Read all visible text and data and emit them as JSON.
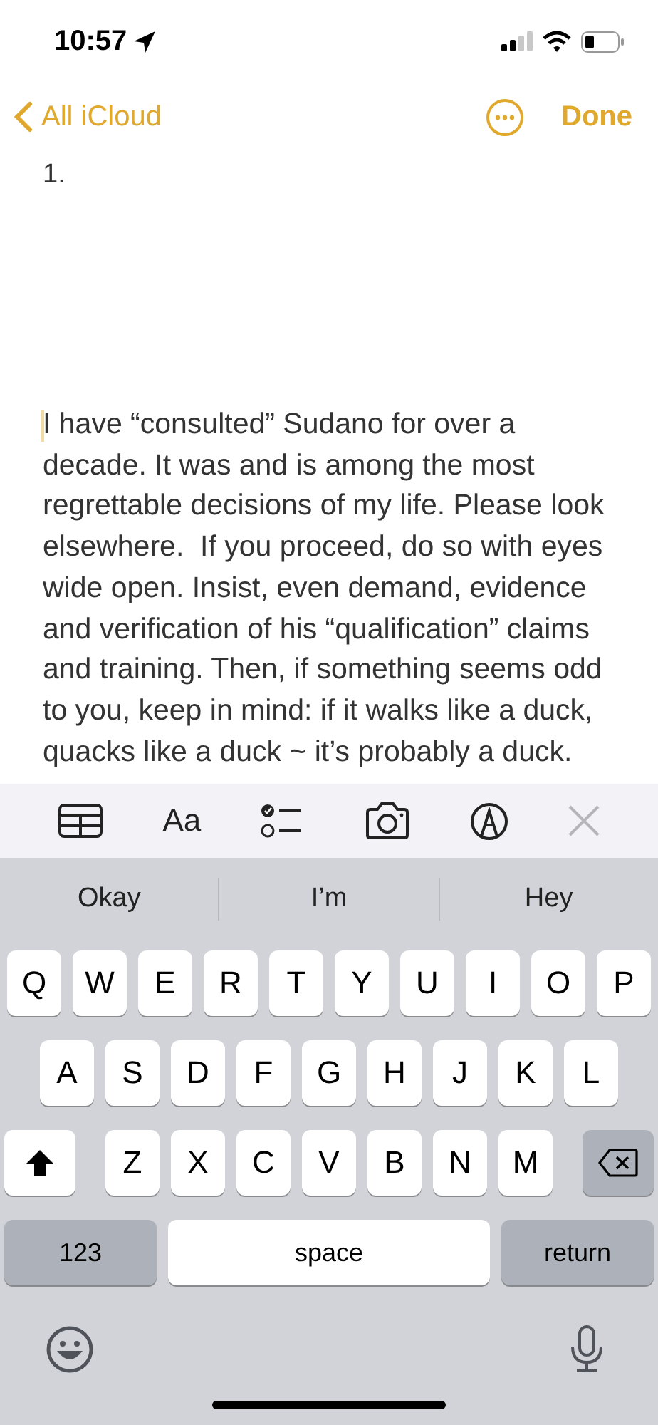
{
  "status_bar": {
    "time": "10:57"
  },
  "nav": {
    "back_label": "All iCloud",
    "done_label": "Done"
  },
  "note": {
    "list_marker": "1.",
    "paragraph": "I have “consulted” Sudano for over a decade. It was and is among the most regrettable decisions of my life. Please look elsewhere.  If you proceed, do so with eyes wide open. Insist, even demand, evidence and verification of his “qualification” claims and training. Then, if something seems odd to you, keep in mind: if it walks like a duck, quacks like a duck ~ it’s probably a duck."
  },
  "format_toolbar": {
    "text_style_label": "Aa"
  },
  "suggestions": [
    "Okay",
    "I’m",
    "Hey"
  ],
  "keyboard": {
    "rows": [
      [
        "Q",
        "W",
        "E",
        "R",
        "T",
        "Y",
        "U",
        "I",
        "O",
        "P"
      ],
      [
        "A",
        "S",
        "D",
        "F",
        "G",
        "H",
        "J",
        "K",
        "L"
      ],
      [
        "Z",
        "X",
        "C",
        "V",
        "B",
        "N",
        "M"
      ]
    ],
    "numbers_key": "123",
    "space_key": "space",
    "return_key": "return"
  }
}
